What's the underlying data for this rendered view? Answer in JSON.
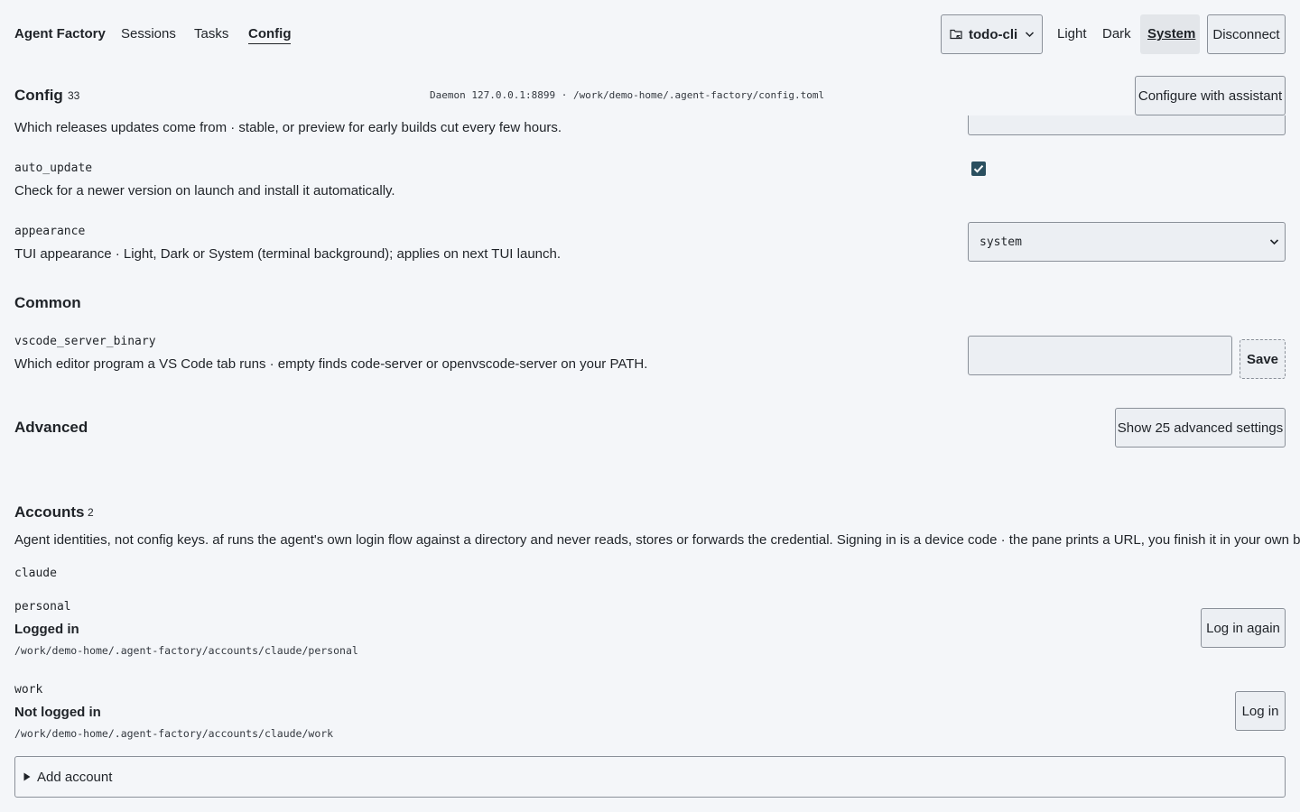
{
  "nav": {
    "brand": "Agent Factory",
    "links": [
      "Sessions",
      "Tasks",
      "Config"
    ],
    "active": "Config",
    "project": "todo-cli",
    "themes": [
      "Light",
      "Dark",
      "System"
    ],
    "theme_selected": "System",
    "disconnect": "Disconnect"
  },
  "config": {
    "title": "Config",
    "count": "33",
    "daemon": "Daemon 127.0.0.1:8899 · /work/demo-home/.agent-factory/config.toml",
    "assistant_button": "Configure with assistant",
    "settings": [
      {
        "key": "",
        "desc": "Which releases updates come from · stable, or preview for early builds cut every few hours."
      },
      {
        "key": "auto_update",
        "desc": "Check for a newer version on launch and install it automatically.",
        "value": true
      },
      {
        "key": "appearance",
        "desc": "TUI appearance · Light, Dark or System (terminal background); applies on next TUI launch.",
        "value": "system"
      }
    ],
    "common": {
      "title": "Common",
      "key": "vscode_server_binary",
      "desc": "Which editor program a VS Code tab runs · empty finds code-server or openvscode-server on your PATH.",
      "value": "",
      "save_label": "Save"
    },
    "advanced": {
      "title": "Advanced",
      "button": "Show 25 advanced settings"
    }
  },
  "accounts": {
    "title": "Accounts",
    "count": "2",
    "desc": "Agent identities, not config keys. af runs the agent's own login flow against a directory and never reads, stores or forwards the credential. Signing in is a device code · the pane prints a URL, you finish it in your own browser.",
    "agent": "claude",
    "items": [
      {
        "name": "personal",
        "status": "Logged in",
        "path": "/work/demo-home/.agent-factory/accounts/claude/personal",
        "action": "Log in again"
      },
      {
        "name": "work",
        "status": "Not logged in",
        "path": "/work/demo-home/.agent-factory/accounts/claude/work",
        "action": "Log in"
      }
    ],
    "add_label": "Add account"
  },
  "colors": {
    "background": "#f4f6f9",
    "control_bg": "#eceff3",
    "checkbox": "#2a4f5f",
    "text": "#1f2328"
  },
  "icons": [
    "folder-icon",
    "chevron-down-icon",
    "checkmark-icon",
    "select-chevron-icon",
    "disclosure-triangle-icon"
  ]
}
